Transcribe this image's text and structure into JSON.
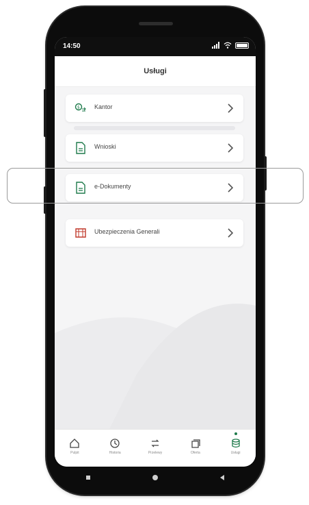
{
  "status": {
    "time": "14:50"
  },
  "header": {
    "title": "Usługi"
  },
  "items": [
    {
      "label": "Kantor",
      "icon": "currency-exchange-icon"
    },
    {
      "label": "Wnioski",
      "icon": "document-icon"
    },
    {
      "label": "e-Dokumenty",
      "icon": "document-icon"
    },
    {
      "label": "Ubezpieczenia Generali",
      "icon": "insurance-icon"
    }
  ],
  "tabs": [
    {
      "label": "Pulpit",
      "icon": "home-icon"
    },
    {
      "label": "Historia",
      "icon": "history-icon"
    },
    {
      "label": "Przelewy",
      "icon": "transfer-icon"
    },
    {
      "label": "Oferta",
      "icon": "offer-icon"
    },
    {
      "label": "Usługi",
      "icon": "services-icon",
      "active": true
    }
  ],
  "colors": {
    "accent": "#1e7a4b",
    "insurance": "#c0392b",
    "background": "#f5f5f6"
  }
}
